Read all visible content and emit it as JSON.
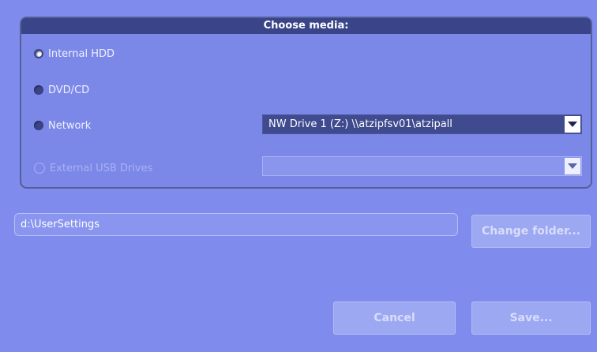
{
  "dialog": {
    "group_title": "Choose media:",
    "media_options": [
      {
        "label": "Internal HDD",
        "selected": true,
        "enabled": true
      },
      {
        "label": "DVD/CD",
        "selected": false,
        "enabled": true
      },
      {
        "label": "Network",
        "selected": false,
        "enabled": true
      },
      {
        "label": "External USB Drives",
        "selected": false,
        "enabled": false
      }
    ],
    "network_drive": {
      "value": "NW Drive 1 (Z:) \\\\atzipfsv01\\atzipall"
    },
    "usb_drive": {
      "value": ""
    },
    "folder_path": "d:\\UserSettings",
    "buttons": {
      "change_folder": "Change folder...",
      "cancel": "Cancel",
      "save": "Save..."
    }
  },
  "colors": {
    "background": "#7f8ced",
    "title_bar": "#3a4589",
    "dropdown": "#3f4a8f"
  }
}
